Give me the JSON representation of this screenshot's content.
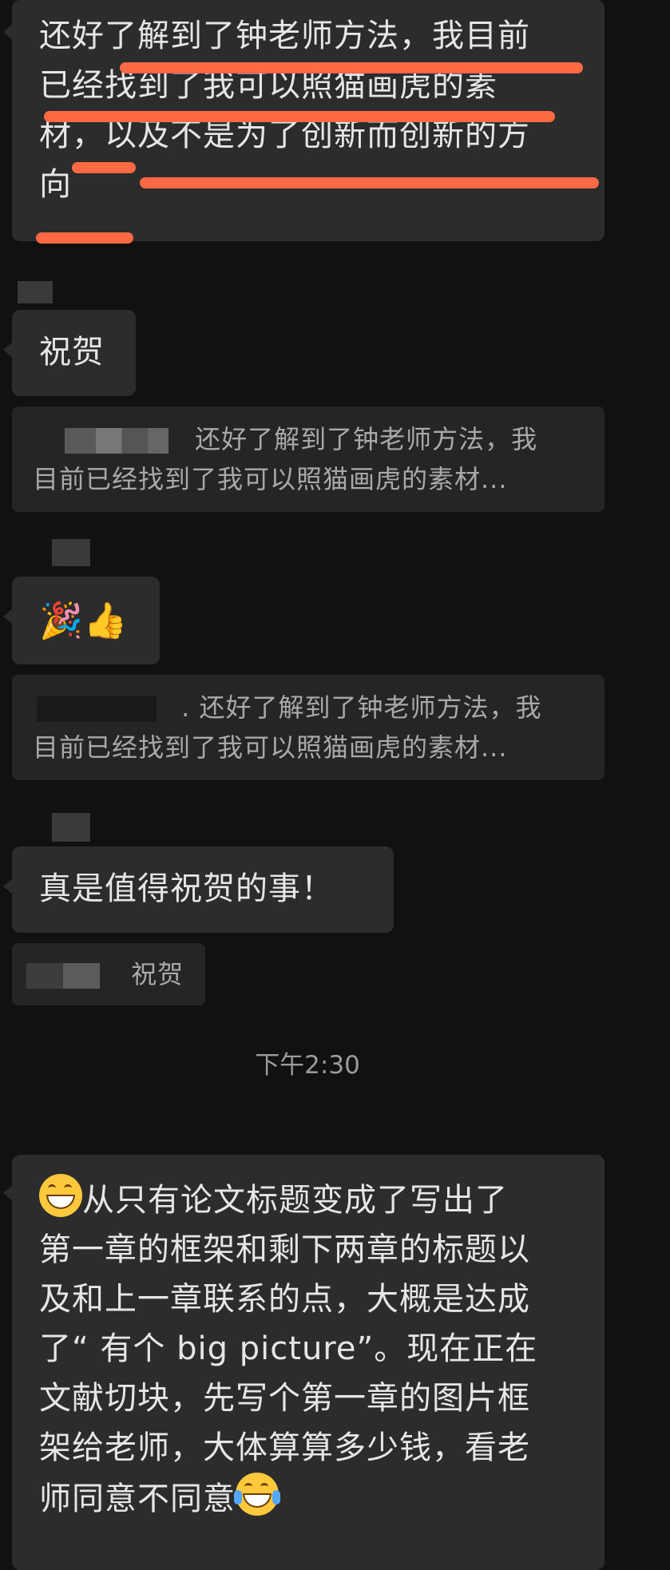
{
  "messages": [
    {
      "lines": [
        "还好了解到了钟老师方法，我目前",
        "已经找到了我可以照猫画虎的素",
        "材，以及不是为了创新而创新的方",
        "向"
      ]
    },
    {
      "text": "祝贺"
    },
    {
      "quote_lines": [
        "还好了解到了钟老师方法，我",
        "目前已经找到了我可以照猫画虎的素材..."
      ]
    },
    {
      "emoji": "🎉👍"
    },
    {
      "quote_lines": [
        ". 还好了解到了钟老师方法，我",
        "目前已经找到了我可以照猫画虎的素材..."
      ]
    },
    {
      "text": "真是值得祝贺的事！"
    },
    {
      "quote_text": "祝贺"
    },
    {
      "lines": [
        "从只有论文标题变成了写出了",
        "第一章的框架和剩下两章的标题以",
        "及和上一章联系的点，大概是达成",
        "了“ 有个 big picture”。现在正在",
        "文献切块，先写个第一章的图片框",
        "架给老师，大体算算多少钱，看老",
        "师同意不同意"
      ]
    }
  ],
  "timestamp": "下午2:30",
  "colors": {
    "underline": "#ff6a45",
    "bubble": "#2c2c2c",
    "background": "#111111"
  },
  "icons": {
    "grin": "grinning-face-icon",
    "cry": "crying-laughing-face-icon",
    "party": "party-popper-icon",
    "thumb": "thumbs-up-icon"
  }
}
